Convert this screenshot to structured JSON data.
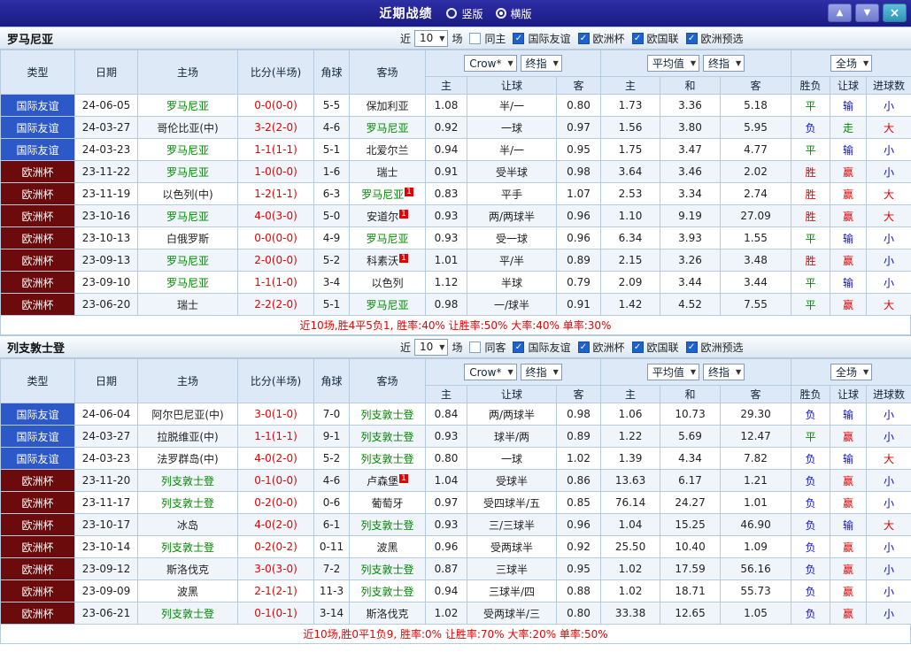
{
  "titlebar": {
    "title": "近期战绩",
    "layout_options": [
      {
        "label": "竖版",
        "selected": false
      },
      {
        "label": "横版",
        "selected": true
      }
    ],
    "up_button": "▲",
    "down_button": "▼",
    "close_button": "×"
  },
  "colors": {
    "type_bg": {
      "国际友谊": "#2d59c8",
      "欧洲杯": "#6b0b0b"
    },
    "result_text": {
      "胜": "#e60000",
      "赢": "#e60000",
      "大": "#e60000",
      "平": "#008a00",
      "走": "#008a00",
      "负": "#1010cc",
      "输": "#1010cc",
      "小": "#1010cc"
    },
    "team_text": "#008a00",
    "score_text": "#e60000"
  },
  "table_header": {
    "type": "类型",
    "date": "日期",
    "home": "主场",
    "score": "比分(半场)",
    "corner": "角球",
    "away": "客场",
    "odds_source": "Crow*",
    "odds_mode": "终指",
    "avg_source": "平均值",
    "avg_mode": "终指",
    "scope": "全场",
    "sub": {
      "odds_home": "主",
      "odds_hcp": "让球",
      "odds_away": "客",
      "avg_home": "主",
      "avg_draw": "和",
      "avg_away": "客",
      "res_outcome": "胜负",
      "res_hcp": "让球",
      "res_goals": "进球数"
    }
  },
  "sections": [
    {
      "team": "罗马尼亚",
      "filter": {
        "near": "近",
        "count": "10",
        "matches": "场",
        "same": "同主",
        "same_checked": false,
        "comps": [
          {
            "label": "国际友谊",
            "checked": true
          },
          {
            "label": "欧洲杯",
            "checked": true
          },
          {
            "label": "欧国联",
            "checked": true
          },
          {
            "label": "欧洲预选",
            "checked": true
          }
        ]
      },
      "rows": [
        {
          "type": "国际友谊",
          "date": "24-06-05",
          "home": "罗马尼亚",
          "home_team": true,
          "score": "0-0(0-0)",
          "corner": "5-5",
          "away": "保加利亚",
          "away_team": false,
          "o1": "1.08",
          "hcp": "半/一",
          "o2": "0.80",
          "a1": "1.73",
          "a2": "3.36",
          "a3": "5.18",
          "r1": "平",
          "r2": "输",
          "r3": "小"
        },
        {
          "type": "国际友谊",
          "date": "24-03-27",
          "home": "哥伦比亚(中)",
          "home_team": false,
          "score": "3-2(2-0)",
          "corner": "4-6",
          "away": "罗马尼亚",
          "away_team": true,
          "o1": "0.92",
          "hcp": "一球",
          "o2": "0.97",
          "a1": "1.56",
          "a2": "3.80",
          "a3": "5.95",
          "r1": "负",
          "r2": "走",
          "r3": "大"
        },
        {
          "type": "国际友谊",
          "date": "24-03-23",
          "home": "罗马尼亚",
          "home_team": true,
          "score": "1-1(1-1)",
          "corner": "5-1",
          "away": "北爱尔兰",
          "away_team": false,
          "o1": "0.94",
          "hcp": "半/一",
          "o2": "0.95",
          "a1": "1.75",
          "a2": "3.47",
          "a3": "4.77",
          "r1": "平",
          "r2": "输",
          "r3": "小"
        },
        {
          "type": "欧洲杯",
          "date": "23-11-22",
          "home": "罗马尼亚",
          "home_team": true,
          "score": "1-0(0-0)",
          "corner": "1-6",
          "away": "瑞士",
          "away_team": false,
          "o1": "0.91",
          "hcp": "受半球",
          "o2": "0.98",
          "a1": "3.64",
          "a2": "3.46",
          "a3": "2.02",
          "r1": "胜",
          "r2": "赢",
          "r3": "小"
        },
        {
          "type": "欧洲杯",
          "date": "23-11-19",
          "home": "以色列(中)",
          "home_team": false,
          "score": "1-2(1-1)",
          "corner": "6-3",
          "away": "罗马尼亚",
          "away_team": true,
          "away_sup": "1",
          "o1": "0.83",
          "hcp": "平手",
          "o2": "1.07",
          "a1": "2.53",
          "a2": "3.34",
          "a3": "2.74",
          "r1": "胜",
          "r2": "赢",
          "r3": "大"
        },
        {
          "type": "欧洲杯",
          "date": "23-10-16",
          "home": "罗马尼亚",
          "home_team": true,
          "score": "4-0(3-0)",
          "corner": "5-0",
          "away": "安道尔",
          "away_team": false,
          "away_sup": "1",
          "o1": "0.93",
          "hcp": "两/两球半",
          "o2": "0.96",
          "a1": "1.10",
          "a2": "9.19",
          "a3": "27.09",
          "r1": "胜",
          "r2": "赢",
          "r3": "大"
        },
        {
          "type": "欧洲杯",
          "date": "23-10-13",
          "home": "白俄罗斯",
          "home_team": false,
          "score": "0-0(0-0)",
          "corner": "4-9",
          "away": "罗马尼亚",
          "away_team": true,
          "o1": "0.93",
          "hcp": "受一球",
          "o2": "0.96",
          "a1": "6.34",
          "a2": "3.93",
          "a3": "1.55",
          "r1": "平",
          "r2": "输",
          "r3": "小"
        },
        {
          "type": "欧洲杯",
          "date": "23-09-13",
          "home": "罗马尼亚",
          "home_team": true,
          "score": "2-0(0-0)",
          "corner": "5-2",
          "away": "科素沃",
          "away_team": false,
          "away_sup": "1",
          "o1": "1.01",
          "hcp": "平/半",
          "o2": "0.89",
          "a1": "2.15",
          "a2": "3.26",
          "a3": "3.48",
          "r1": "胜",
          "r2": "赢",
          "r3": "小"
        },
        {
          "type": "欧洲杯",
          "date": "23-09-10",
          "home": "罗马尼亚",
          "home_team": true,
          "score": "1-1(1-0)",
          "corner": "3-4",
          "away": "以色列",
          "away_team": false,
          "o1": "1.12",
          "hcp": "半球",
          "o2": "0.79",
          "a1": "2.09",
          "a2": "3.44",
          "a3": "3.44",
          "r1": "平",
          "r2": "输",
          "r3": "小"
        },
        {
          "type": "欧洲杯",
          "date": "23-06-20",
          "home": "瑞士",
          "home_team": false,
          "score": "2-2(2-0)",
          "corner": "5-1",
          "away": "罗马尼亚",
          "away_team": true,
          "o1": "0.98",
          "hcp": "一/球半",
          "o2": "0.91",
          "a1": "1.42",
          "a2": "4.52",
          "a3": "7.55",
          "r1": "平",
          "r2": "赢",
          "r3": "大"
        }
      ],
      "summary": "近10场,胜4平5负1, 胜率:40% 让胜率:50% 大率:40% 单率:30%"
    },
    {
      "team": "列支敦士登",
      "filter": {
        "near": "近",
        "count": "10",
        "matches": "场",
        "same": "同客",
        "same_checked": false,
        "comps": [
          {
            "label": "国际友谊",
            "checked": true
          },
          {
            "label": "欧洲杯",
            "checked": true
          },
          {
            "label": "欧国联",
            "checked": true
          },
          {
            "label": "欧洲预选",
            "checked": true
          }
        ]
      },
      "rows": [
        {
          "type": "国际友谊",
          "date": "24-06-04",
          "home": "阿尔巴尼亚(中)",
          "home_team": false,
          "score": "3-0(1-0)",
          "corner": "7-0",
          "away": "列支敦士登",
          "away_team": true,
          "o1": "0.84",
          "hcp": "两/两球半",
          "o2": "0.98",
          "a1": "1.06",
          "a2": "10.73",
          "a3": "29.30",
          "r1": "负",
          "r2": "输",
          "r3": "小"
        },
        {
          "type": "国际友谊",
          "date": "24-03-27",
          "home": "拉脱维亚(中)",
          "home_team": false,
          "score": "1-1(1-1)",
          "corner": "9-1",
          "away": "列支敦士登",
          "away_team": true,
          "o1": "0.93",
          "hcp": "球半/两",
          "o2": "0.89",
          "a1": "1.22",
          "a2": "5.69",
          "a3": "12.47",
          "r1": "平",
          "r2": "赢",
          "r3": "小"
        },
        {
          "type": "国际友谊",
          "date": "24-03-23",
          "home": "法罗群岛(中)",
          "home_team": false,
          "score": "4-0(2-0)",
          "corner": "5-2",
          "away": "列支敦士登",
          "away_team": true,
          "o1": "0.80",
          "hcp": "一球",
          "o2": "1.02",
          "a1": "1.39",
          "a2": "4.34",
          "a3": "7.82",
          "r1": "负",
          "r2": "输",
          "r3": "大"
        },
        {
          "type": "欧洲杯",
          "date": "23-11-20",
          "home": "列支敦士登",
          "home_team": true,
          "score": "0-1(0-0)",
          "corner": "4-6",
          "away": "卢森堡",
          "away_team": false,
          "away_sup": "1",
          "o1": "1.04",
          "hcp": "受球半",
          "o2": "0.86",
          "a1": "13.63",
          "a2": "6.17",
          "a3": "1.21",
          "r1": "负",
          "r2": "赢",
          "r3": "小"
        },
        {
          "type": "欧洲杯",
          "date": "23-11-17",
          "home": "列支敦士登",
          "home_team": true,
          "score": "0-2(0-0)",
          "corner": "0-6",
          "away": "葡萄牙",
          "away_team": false,
          "o1": "0.97",
          "hcp": "受四球半/五",
          "o2": "0.85",
          "a1": "76.14",
          "a2": "24.27",
          "a3": "1.01",
          "r1": "负",
          "r2": "赢",
          "r3": "小"
        },
        {
          "type": "欧洲杯",
          "date": "23-10-17",
          "home": "冰岛",
          "home_team": false,
          "score": "4-0(2-0)",
          "corner": "6-1",
          "away": "列支敦士登",
          "away_team": true,
          "o1": "0.93",
          "hcp": "三/三球半",
          "o2": "0.96",
          "a1": "1.04",
          "a2": "15.25",
          "a3": "46.90",
          "r1": "负",
          "r2": "输",
          "r3": "大"
        },
        {
          "type": "欧洲杯",
          "date": "23-10-14",
          "home": "列支敦士登",
          "home_team": true,
          "score": "0-2(0-2)",
          "corner": "0-11",
          "away": "波黑",
          "away_team": false,
          "o1": "0.96",
          "hcp": "受两球半",
          "o2": "0.92",
          "a1": "25.50",
          "a2": "10.40",
          "a3": "1.09",
          "r1": "负",
          "r2": "赢",
          "r3": "小"
        },
        {
          "type": "欧洲杯",
          "date": "23-09-12",
          "home": "斯洛伐克",
          "home_team": false,
          "score": "3-0(3-0)",
          "corner": "7-2",
          "away": "列支敦士登",
          "away_team": true,
          "o1": "0.87",
          "hcp": "三球半",
          "o2": "0.95",
          "a1": "1.02",
          "a2": "17.59",
          "a3": "56.16",
          "r1": "负",
          "r2": "赢",
          "r3": "小"
        },
        {
          "type": "欧洲杯",
          "date": "23-09-09",
          "home": "波黑",
          "home_team": false,
          "score": "2-1(2-1)",
          "corner": "11-3",
          "away": "列支敦士登",
          "away_team": true,
          "o1": "0.94",
          "hcp": "三球半/四",
          "o2": "0.88",
          "a1": "1.02",
          "a2": "18.71",
          "a3": "55.73",
          "r1": "负",
          "r2": "赢",
          "r3": "小"
        },
        {
          "type": "欧洲杯",
          "date": "23-06-21",
          "home": "列支敦士登",
          "home_team": true,
          "score": "0-1(0-1)",
          "corner": "3-14",
          "away": "斯洛伐克",
          "away_team": false,
          "o1": "1.02",
          "hcp": "受两球半/三",
          "o2": "0.80",
          "a1": "33.38",
          "a2": "12.65",
          "a3": "1.05",
          "r1": "负",
          "r2": "赢",
          "r3": "小"
        }
      ],
      "summary": "近10场,胜0平1负9, 胜率:0% 让胜率:70% 大率:20% 单率:50%"
    }
  ]
}
